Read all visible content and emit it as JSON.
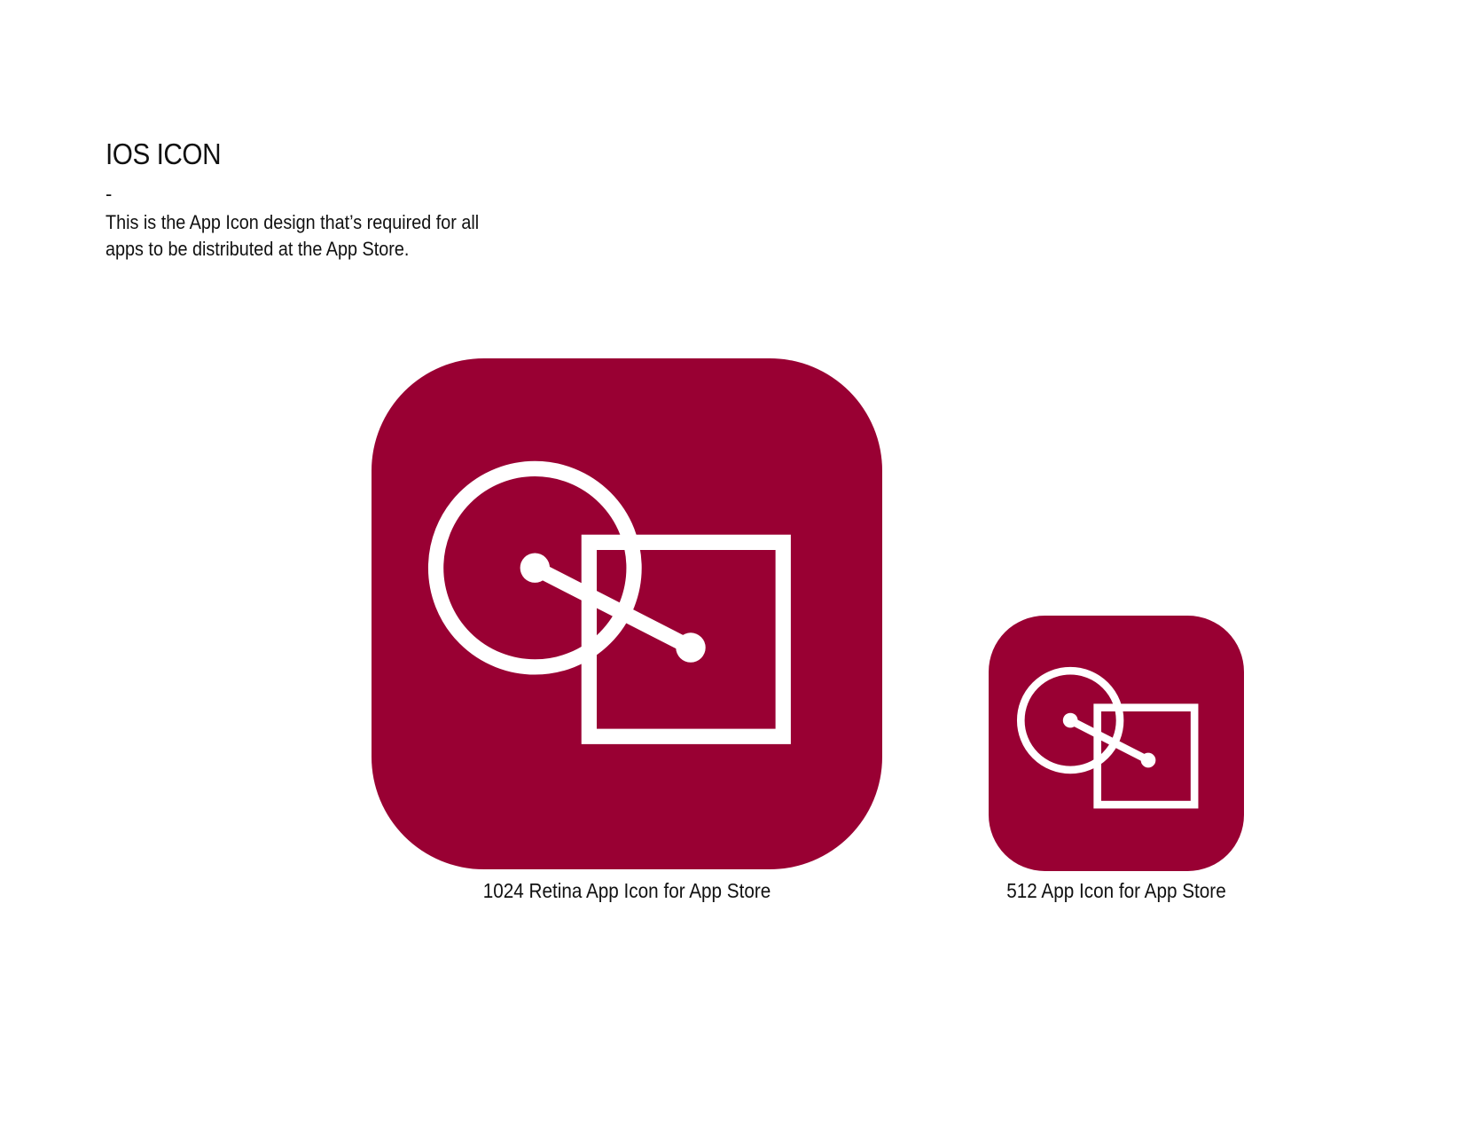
{
  "header": {
    "title": "IOS ICON",
    "separator": "-",
    "description": "This is the App Icon design that’s required for all apps to be distributed at the App Store."
  },
  "icons": [
    {
      "size_label": "1024 Retina App Icon for App Store",
      "icon_name": "app-icon-circle-square-link"
    },
    {
      "size_label": "512 App Icon for App Store",
      "icon_name": "app-icon-circle-square-link"
    }
  ],
  "colors": {
    "icon_background": "#990033",
    "icon_foreground": "#ffffff",
    "text": "#111111",
    "page_background": "#ffffff"
  }
}
